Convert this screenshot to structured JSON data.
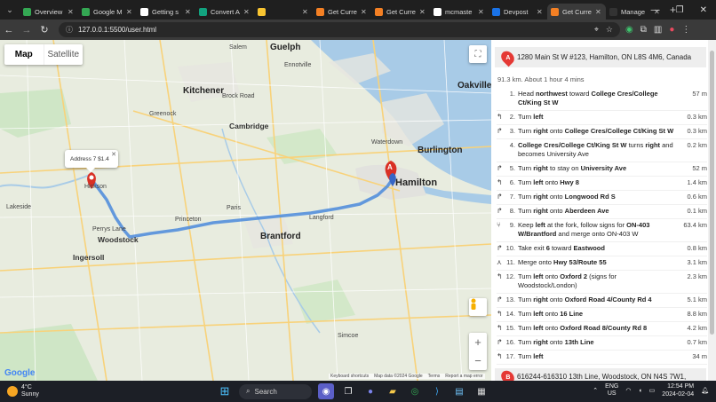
{
  "browser": {
    "tabs": [
      {
        "label": "Overview",
        "fav_color": "#34a853"
      },
      {
        "label": "Google M",
        "fav_color": "#34a853"
      },
      {
        "label": "Getting s",
        "fav_color": "#ffffff"
      },
      {
        "label": "Convert A",
        "fav_color": "#12a37f"
      },
      {
        "label": "",
        "fav_color": "#f9c531"
      },
      {
        "label": "Get Curre",
        "fav_color": "#f48024"
      },
      {
        "label": "Get Curre",
        "fav_color": "#f48024"
      },
      {
        "label": "mcmaste",
        "fav_color": "#ffffff"
      },
      {
        "label": "Devpost",
        "fav_color": "#1a73e8"
      },
      {
        "label": "Get Curre",
        "fav_color": "#f48024"
      },
      {
        "label": "Manage",
        "fav_color": "#333333"
      }
    ],
    "active_tab_index": 9,
    "url": "127.0.0.1:5500/user.html"
  },
  "map": {
    "type_map": "Map",
    "type_satellite": "Satellite",
    "infowindow_text": "Address 7 $1.4",
    "labels": {
      "guelph": "Guelph",
      "kitchener": "Kitchener",
      "oakville": "Oakville",
      "burlington": "Burlington",
      "hamilton": "Hamilton",
      "brantford": "Brantford",
      "woodstock": "Woodstock",
      "ingersoll": "Ingersoll",
      "hickson": "Hickson",
      "cambridge": "Cambridge",
      "simcoe": "Simcoe",
      "waterdown": "Waterdown",
      "paris": "Paris",
      "princeton": "Princeton",
      "langford": "Langford",
      "lakeside": "Lakeside",
      "perrys_lane": "Perrys Lane",
      "salem": "Salem",
      "ennotville": "Ennotville",
      "brock_road": "Brock Road",
      "greenock": "Greenock"
    },
    "footer": {
      "logo": "Google",
      "shortcuts": "Keyboard shortcuts",
      "mapdata": "Map data ©2024 Google",
      "terms": "Terms",
      "report": "Report a map error"
    }
  },
  "directions": {
    "start_marker": "A",
    "start_address": "1280 Main St W #123, Hamilton, ON L8S 4M6, Canada",
    "summary": "91.3 km. About 1 hour 4 mins",
    "steps": [
      {
        "icon": "",
        "num": "1.",
        "pre": "Head ",
        "b1": "northwest",
        "mid": " toward ",
        "b2": "College Cres/College Ct/King St W",
        "post": "",
        "dist": "57 m"
      },
      {
        "icon": "↰",
        "num": "2.",
        "pre": "Turn ",
        "b1": "left",
        "mid": "",
        "b2": "",
        "post": "",
        "dist": "0.3 km"
      },
      {
        "icon": "↱",
        "num": "3.",
        "pre": "Turn ",
        "b1": "right",
        "mid": " onto ",
        "b2": "College Cres/College Ct/King St W",
        "post": "",
        "dist": "0.3 km"
      },
      {
        "icon": "",
        "num": "4.",
        "pre": "",
        "b1": "College Cres/College Ct/King St W",
        "mid": " turns ",
        "b2": "right",
        "post": " and becomes University Ave",
        "dist": "0.2 km"
      },
      {
        "icon": "↱",
        "num": "5.",
        "pre": "Turn ",
        "b1": "right",
        "mid": " to stay on ",
        "b2": "University Ave",
        "post": "",
        "dist": "52 m"
      },
      {
        "icon": "↰",
        "num": "6.",
        "pre": "Turn ",
        "b1": "left",
        "mid": " onto ",
        "b2": "Hwy 8",
        "post": "",
        "dist": "1.4 km"
      },
      {
        "icon": "↱",
        "num": "7.",
        "pre": "Turn ",
        "b1": "right",
        "mid": " onto ",
        "b2": "Longwood Rd S",
        "post": "",
        "dist": "0.6 km"
      },
      {
        "icon": "↱",
        "num": "8.",
        "pre": "Turn ",
        "b1": "right",
        "mid": " onto ",
        "b2": "Aberdeen Ave",
        "post": "",
        "dist": "0.1 km"
      },
      {
        "icon": "⑂",
        "num": "9.",
        "pre": "Keep ",
        "b1": "left",
        "mid": " at the fork, follow signs for ",
        "b2": "ON-403 W/Brantford",
        "post": " and merge onto ON-403 W",
        "dist": "63.4 km"
      },
      {
        "icon": "↱",
        "num": "10.",
        "pre": "Take exit ",
        "b1": "6",
        "mid": " toward ",
        "b2": "Eastwood",
        "post": "",
        "dist": "0.8 km"
      },
      {
        "icon": "⋏",
        "num": "11.",
        "pre": "Merge onto ",
        "b1": "Hwy 53/Route 55",
        "mid": "",
        "b2": "",
        "post": "",
        "dist": "3.1 km"
      },
      {
        "icon": "↰",
        "num": "12.",
        "pre": "Turn ",
        "b1": "left",
        "mid": " onto ",
        "b2": "Oxford 2",
        "post": " (signs for Woodstock/London)",
        "dist": "2.3 km"
      },
      {
        "icon": "↱",
        "num": "13.",
        "pre": "Turn ",
        "b1": "right",
        "mid": " onto ",
        "b2": "Oxford Road 4/County Rd 4",
        "post": "",
        "dist": "5.1 km"
      },
      {
        "icon": "↰",
        "num": "14.",
        "pre": "Turn ",
        "b1": "left",
        "mid": " onto ",
        "b2": "16 Line",
        "post": "",
        "dist": "8.8 km"
      },
      {
        "icon": "↰",
        "num": "15.",
        "pre": "Turn ",
        "b1": "left",
        "mid": " onto ",
        "b2": "Oxford Road 8/County Rd 8",
        "post": "",
        "dist": "4.2 km"
      },
      {
        "icon": "↱",
        "num": "16.",
        "pre": "Turn ",
        "b1": "right",
        "mid": " onto ",
        "b2": "13th Line",
        "post": "",
        "dist": "0.7 km"
      },
      {
        "icon": "↰",
        "num": "17.",
        "pre": "Turn ",
        "b1": "left",
        "mid": "",
        "b2": "",
        "post": "",
        "dist": "34 m"
      }
    ],
    "end_marker": "B",
    "end_address": "616244-616310 13th Line, Woodstock, ON N4S 7W1,"
  },
  "taskbar": {
    "temp": "4°C",
    "condition": "Sunny",
    "search_placeholder": "Search",
    "lang1": "ENG",
    "lang2": "US",
    "time": "12:54 PM",
    "date": "2024-02-04"
  }
}
